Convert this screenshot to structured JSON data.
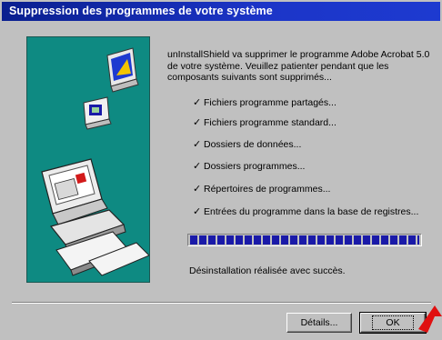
{
  "window": {
    "title": "Suppression des programmes de votre système"
  },
  "content": {
    "description": "unInstallShield va supprimer le programme Adobe Acrobat 5.0 de votre système. Veuillez patienter pendant que les composants suivants sont supprimés...",
    "steps": [
      "Fichiers programme partagés...",
      "Fichiers programme standard...",
      "Dossiers de données...",
      "Dossiers programmes...",
      "Répertoires de programmes...",
      "Entrées du programme dans la base de registres..."
    ],
    "progress_percent": 100,
    "status": "Désinstallation réalisée avec succès."
  },
  "buttons": {
    "details": "Détails...",
    "ok": "OK"
  },
  "colors": {
    "title_bar": "#1c35c8",
    "illustration_bg": "#0e8a82",
    "progress_fill": "#1a1aa8",
    "pointer": "#e01010"
  }
}
